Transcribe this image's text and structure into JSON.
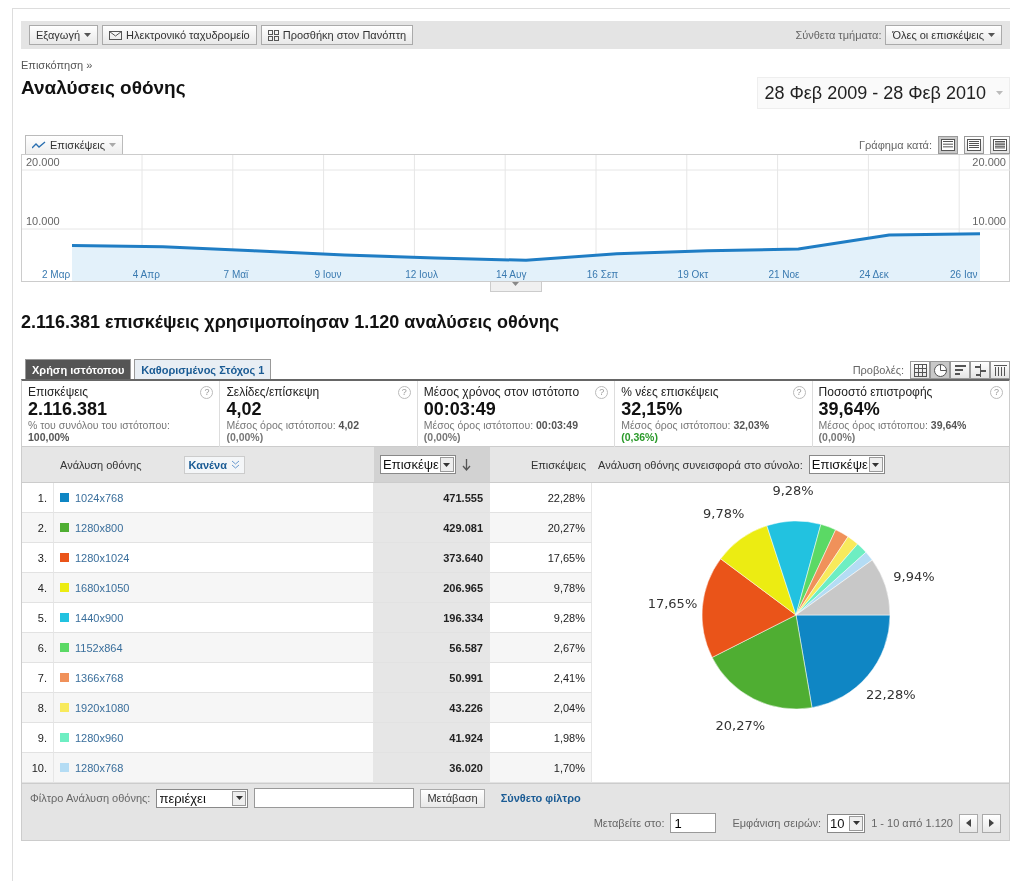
{
  "toolbar": {
    "buttons": [
      {
        "label": "Εξαγωγή",
        "kind": "dropdown"
      },
      {
        "label": "Ηλεκτρονικό ταχυδρομείο",
        "kind": "mail"
      },
      {
        "label": "Προσθήκη στον Πανόπτη",
        "kind": "grid"
      }
    ],
    "segment_label": "Σύνθετα τμήματα:",
    "segment_value": "Όλες οι επισκέψεις"
  },
  "breadcrumb": "Επισκόπηση »",
  "title": "Αναλύσεις οθόνης",
  "date_range": "28 Φεβ 2009 - 28 Φεβ 2010",
  "graph": {
    "graph_by_label": "Γράφημα κατά:",
    "graph_by": [
      {
        "kind": "day",
        "selected": true
      },
      {
        "kind": "week",
        "selected": false
      },
      {
        "kind": "month",
        "selected": false
      }
    ],
    "chart_data": {
      "type": "area",
      "grid": true,
      "ylim": [
        0,
        20000
      ],
      "yticks": [
        {
          "value": 10000,
          "label": "10.000"
        },
        {
          "value": 20000,
          "label": "20.000"
        }
      ],
      "categories": [
        "2 Μαρ",
        "4 Απρ",
        "7 Μαϊ",
        "9 Ιουν",
        "12 Ιουλ",
        "14 Αυγ",
        "16 Σεπ",
        "19 Οκτ",
        "21 Νοε",
        "24 Δεκ",
        "26 Ιαν"
      ],
      "series": [
        {
          "name": "Επισκέψεις",
          "color": "#1f7dc4",
          "values": [
            7200,
            7000,
            6300,
            5600,
            5100,
            4700,
            5800,
            6300,
            6600,
            9000,
            9200
          ]
        }
      ]
    }
  },
  "summary": "2.116.381 επισκέψεις χρησιμοποίησαν 1.120 αναλύσεις οθόνης",
  "tabs": [
    {
      "label": "Χρήση ιστότοπου",
      "selected": true
    },
    {
      "label": "Καθορισμένος Στόχος 1",
      "selected": false
    }
  ],
  "views_label": "Προβολές:",
  "views": [
    {
      "kind": "table",
      "selected": false
    },
    {
      "kind": "pie",
      "selected": true
    },
    {
      "kind": "bars",
      "selected": false
    },
    {
      "kind": "compare",
      "selected": false
    },
    {
      "kind": "pivot",
      "selected": false
    }
  ],
  "metrics": [
    {
      "label": "Επισκέψεις",
      "help": "?",
      "value": "2.116.381",
      "sub": "% του συνόλου του ιστότοπου: **100,00%**"
    },
    {
      "label": "Σελίδες/επίσκεψη",
      "help": "?",
      "value": "4,02",
      "sub": "Μέσος όρος ιστότοπου: **4,02**",
      "delta": "(0,00%)",
      "color": "#777777"
    },
    {
      "label": "Μέσος χρόνος στον ιστότοπο",
      "help": "?",
      "value": "00:03:49",
      "sub": "Μέσος όρος ιστότοπου: **00:03:49**",
      "delta": "(0,00%)",
      "color": "#777777"
    },
    {
      "label": "% νέες επισκέψεις",
      "help": "?",
      "value": "32,15%",
      "sub": "Μέσος όρος ιστότοπου: **32,03%**",
      "delta": "(0,36%)",
      "color": "#2a9a2a"
    },
    {
      "label": "Ποσοστό επιστροφής",
      "help": "?",
      "value": "39,64%",
      "sub": "Μέσος όρος ιστότοπου: **39,64%**",
      "delta": "(0,00%)",
      "color": "#777777"
    }
  ],
  "table": {
    "dimension_header": "Ανάλυση οθόνης",
    "secondary": "Κανένα",
    "sort_select": "Επισκέψε",
    "visits_header": "Επισκέψεις",
    "contribution_label": "Ανάλυση οθόνης συνεισφορά στο σύνολο:",
    "contribution_select": "Επισκέψε",
    "rows": [
      {
        "rank": "1.",
        "name": "1024x768",
        "color": "#0f86c4",
        "visits": "471.555",
        "share": "22,28%"
      },
      {
        "rank": "2.",
        "name": "1280x800",
        "color": "#4fae32",
        "visits": "429.081",
        "share": "20,27%"
      },
      {
        "rank": "3.",
        "name": "1280x1024",
        "color": "#ea5419",
        "visits": "373.640",
        "share": "17,65%"
      },
      {
        "rank": "4.",
        "name": "1680x1050",
        "color": "#ecec12",
        "visits": "206.965",
        "share": "9,78%"
      },
      {
        "rank": "5.",
        "name": "1440x900",
        "color": "#22c2e0",
        "visits": "196.334",
        "share": "9,28%"
      },
      {
        "rank": "6.",
        "name": "1152x864",
        "color": "#5bd965",
        "visits": "56.587",
        "share": "2,67%"
      },
      {
        "rank": "7.",
        "name": "1366x768",
        "color": "#f0915a",
        "visits": "50.991",
        "share": "2,41%"
      },
      {
        "rank": "8.",
        "name": "1920x1080",
        "color": "#f8ea5c",
        "visits": "43.226",
        "share": "2,04%"
      },
      {
        "rank": "9.",
        "name": "1280x960",
        "color": "#6eeec2",
        "visits": "41.924",
        "share": "1,98%"
      },
      {
        "rank": "10.",
        "name": "1280x768",
        "color": "#b4dcf4",
        "visits": "36.020",
        "share": "1,70%"
      }
    ],
    "pie": {
      "chart_data": {
        "type": "pie",
        "values": [
          22.28,
          20.27,
          17.65,
          9.78,
          9.28,
          2.67,
          2.41,
          2.04,
          1.98,
          1.7,
          9.94
        ],
        "colors": [
          "#0f86c4",
          "#4fae32",
          "#ea5419",
          "#ecec12",
          "#22c2e0",
          "#5bd965",
          "#f0915a",
          "#f8ea5c",
          "#6eeec2",
          "#b4dcf4",
          "#c8c8c8"
        ],
        "value_labels": [
          "22,28%",
          "20,27%",
          "17,65%",
          "9,78%",
          "9,28%",
          null,
          null,
          null,
          null,
          null,
          "9,94%"
        ]
      }
    }
  },
  "footer": {
    "filter_label": "Φίλτρο Ανάλυση οθόνης:",
    "filter_op": "περιέχει",
    "go": "Μετάβαση",
    "advanced": "Σύνθετο φίλτρο",
    "goto_label": "Μεταβείτε στο:",
    "goto_value": "1",
    "rows_label": "Εμφάνιση σειρών:",
    "rows_value": "10",
    "range": "1 - 10 από 1.120"
  }
}
